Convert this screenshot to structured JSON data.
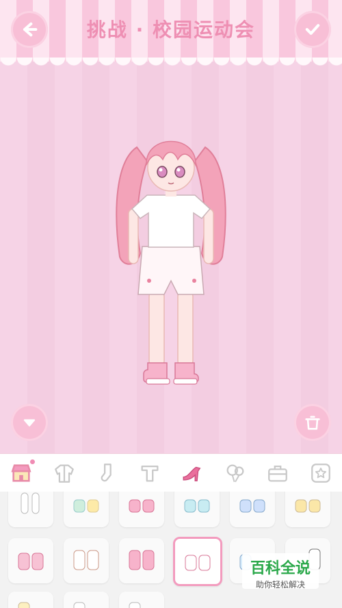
{
  "header": {
    "title": "挑战 · 校园运动会",
    "back_icon": "arrow-left-icon",
    "confirm_icon": "check-icon"
  },
  "stage": {
    "down_icon": "triangle-down-icon",
    "trash_icon": "trash-icon"
  },
  "category_tabs": [
    {
      "icon": "shop-icon",
      "selected": true
    },
    {
      "icon": "jacket-icon"
    },
    {
      "icon": "sock-icon"
    },
    {
      "icon": "top-icon"
    },
    {
      "icon": "high-heel-icon"
    },
    {
      "icon": "balloon-icon"
    },
    {
      "icon": "bag-icon"
    },
    {
      "icon": "star-icon"
    }
  ],
  "watermark": {
    "line1": "百科全说",
    "line2": "助你轻松解决"
  },
  "colors": {
    "accent": "#ee8fb3",
    "button": "#f8bfd6",
    "selected_border": "#f39bbe"
  }
}
